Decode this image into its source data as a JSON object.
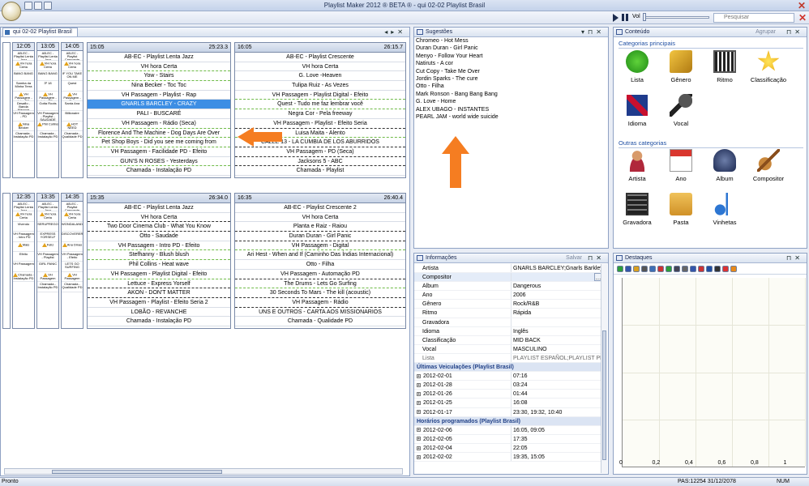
{
  "window": {
    "title": "Playlist Maker 2012 ® BETA ® - qui 02-02 Playlist Brasil"
  },
  "toolbar": {
    "volume_label": "Vol",
    "search_placeholder": "Pesquisar"
  },
  "schedule": {
    "tab": "qui 02-02 Playlist Brasil",
    "blocks": [
      {
        "time": "15:05",
        "duration": "25:23.3",
        "rows": [
          {
            "t": "AB-EC - Playlist Lenta Jazz",
            "s": ""
          },
          {
            "t": "VH hora Certa",
            "s": "dg"
          },
          {
            "t": "Yow - Stairs",
            "s": "dg"
          },
          {
            "t": "Nina Becker - Toc Toc",
            "s": ""
          },
          {
            "t": "VH Passagem - Playlist - Rap",
            "s": ""
          },
          {
            "t": "GNARLS BARCLEY - CRAZY",
            "s": "sel"
          },
          {
            "t": "PALI - BUSCARÉ",
            "s": ""
          },
          {
            "t": "VH Passagem - Rádio (Seca)",
            "s": "dg"
          },
          {
            "t": "Florence And The Machine - Dog Days Are Over",
            "s": "dg"
          },
          {
            "t": "Pet Shop Boys - Did you see me coming from",
            "s": "dg"
          },
          {
            "t": "VH Passagem - Facilidade PD - Efeito",
            "s": ""
          },
          {
            "t": "GUN'S N ROSES - Yesterdays",
            "s": "dg"
          },
          {
            "t": "Chamada - Instalação PD",
            "s": ""
          }
        ]
      },
      {
        "time": "16:05",
        "duration": "26:15.7",
        "rows": [
          {
            "t": "AB-EC - Playlist Crescente",
            "s": ""
          },
          {
            "t": "VH hora Certa",
            "s": ""
          },
          {
            "t": "G. Love -Heaven",
            "s": ""
          },
          {
            "t": "Tulipa Ruiz - As Vezes",
            "s": ""
          },
          {
            "t": "VH Passagem - Playlist Digital - Efeito",
            "s": "dg"
          },
          {
            "t": "Quest - Tudo me faz lembrar você",
            "s": "dg"
          },
          {
            "t": "Negra Cor - Pela freeway",
            "s": ""
          },
          {
            "t": "VH Passagem - Playlist - Efeito Seria",
            "s": "db"
          },
          {
            "t": "Luisa Maita - Alento",
            "s": "dg"
          },
          {
            "t": "CALLE 13 - LA CUMBIA DE LOS ABURRIDOS",
            "s": "db"
          },
          {
            "t": "VH Passagem - PD (Seca)",
            "s": "db"
          },
          {
            "t": "Jacksons 5 - ABC",
            "s": "db"
          },
          {
            "t": "Chamada - Playlist",
            "s": ""
          }
        ]
      },
      {
        "time": "15:35",
        "duration": "26:34.0",
        "rows": [
          {
            "t": "AB-EC - Playlist Lenta Jazz",
            "s": ""
          },
          {
            "t": "VH hora Certa",
            "s": "db"
          },
          {
            "t": "Two Door Cinema Club - What You Know",
            "s": "db"
          },
          {
            "t": "Otto - Saudade",
            "s": ""
          },
          {
            "t": "VH Passagem - Intro PD - Efeito",
            "s": "dg"
          },
          {
            "t": "Stefhanny - Blush blush",
            "s": "dg"
          },
          {
            "t": "Phil Collins - Heat wave",
            "s": ""
          },
          {
            "t": "VH Passagem - Playlist Digital - Efeito",
            "s": "dg"
          },
          {
            "t": "Lettuce - Express Yorself",
            "s": "db"
          },
          {
            "t": "AKON - DON'T MATTER",
            "s": "db"
          },
          {
            "t": "VH Passagem - Playlist - Efeito Seria 2",
            "s": ""
          },
          {
            "t": "LOBÃO - REVANCHE",
            "s": ""
          },
          {
            "t": "Chamada - Instalação PD",
            "s": ""
          }
        ]
      },
      {
        "time": "16:35",
        "duration": "26:40.4",
        "rows": [
          {
            "t": "AB-EC - Playlist Crescente 2",
            "s": ""
          },
          {
            "t": "VH hora Certa",
            "s": ""
          },
          {
            "t": "Planta e Raiz - Raiou",
            "s": "db"
          },
          {
            "t": "Duran Duran - Girl Panic",
            "s": "db"
          },
          {
            "t": "VH Passagem - Digital",
            "s": "dg"
          },
          {
            "t": "Ari Hest - When and If (Caminho Das Índias Internacional)",
            "s": ""
          },
          {
            "t": "Otto - Filha",
            "s": ""
          },
          {
            "t": "VH Passagem - Automação PD",
            "s": "db"
          },
          {
            "t": "The Drums - Lets Go Surfing",
            "s": "dg"
          },
          {
            "t": "30 Seconds To Mars - The kill (acoustic)",
            "s": "db"
          },
          {
            "t": "VH Passagem - Rádio",
            "s": "db"
          },
          {
            "t": "UNS E OUTROS - CARTA  AOS MISSIONARIOS",
            "s": ""
          },
          {
            "t": "Chamada - Qualidade PD",
            "s": ""
          }
        ]
      }
    ],
    "minis": [
      {
        "time": "12:05",
        "rows": [
          "AB-EC - Playlist Lenta Jazz",
          "VH hora Certa",
          "BANG BANG",
          "Samba da Minha Terra",
          "VH Passagem - Intro PD",
          "Desafio - Banda Mangue",
          "VH Passagem - PD",
          "Nina Becker",
          "Chamada - Instalação PD"
        ]
      },
      {
        "time": "13:05",
        "rows": [
          "AB-EC - Playlist Lenta Jazz",
          "VH hora Certa",
          "BANG BANG",
          "3º 18",
          "VH Passagem - Intro PD - Efeito",
          "Gotta Roots",
          "VH Passagem - Playlist - SAUDADE",
          "Phil Collins",
          "Chamada - Instalação PD"
        ]
      },
      {
        "time": "14:05",
        "rows": [
          "AB-EC - Playlist Crescente",
          "VH hora Certa",
          "IF YOU TAKE ON ME",
          "Quest",
          "VH Passagem - Rap",
          "Santa Ana",
          "Billionaire",
          "HOT NEED",
          "Chamada - Qualidade PD"
        ]
      },
      {
        "time": "12:35",
        "rows": [
          "AB-EC - Playlist Lenta Jazz",
          "VH hora Certa",
          "Vivendo",
          "VH Passagem - Intro PD",
          "Mais",
          "Efeito",
          "VH Passagem",
          "Chamada - Instalação PD"
        ]
      },
      {
        "time": "13:35",
        "rows": [
          "AB-EC - Playlist Lenta Jazz",
          "VH hora Certa",
          "SERUPREGO",
          "EXPRESS YORSELF",
          "Feliz",
          "VH Passagem - Playlist",
          "GIRL PANIC",
          "VH Passagem",
          "Chamada - Instalação PD"
        ]
      },
      {
        "time": "14:35",
        "rows": [
          "AB-EC - Playlist Crescente",
          "VH hora Certa",
          "WONDALAND",
          "DISCOVERER",
          "Ana Dinas",
          "VH Passagem - Efeito",
          "LETS GO SURFING",
          "VH Passagem",
          "Chamada - Qualidade PD"
        ]
      }
    ]
  },
  "suggestions": {
    "title": "Sugestões",
    "items": [
      "Chromeo - Hot Mess",
      "Duran Duran - Girl Panic",
      "Menyo - Follow Your Heart",
      "Natiruts - A cor",
      "Cut Copy - Take Me Over",
      "Jordin Sparks - The cure",
      "Otto - Filha",
      "Mark Ronson - Bang Bang Bang",
      "G. Love - Home",
      "ALEX UBAGO - INSTANTES",
      "PEARL JAM   - world wide suicide"
    ]
  },
  "content": {
    "title": "Conteúdo",
    "group_label": "Agrupar",
    "main_section": "Categorias principais",
    "other_section": "Outras categorias",
    "main": [
      "Lista",
      "Gênero",
      "Ritmo",
      "Classificação",
      "Idioma",
      "Vocal"
    ],
    "other": [
      "Artista",
      "Ano",
      "Album",
      "Compositor",
      "Gravadora",
      "Pasta",
      "Vinhetas"
    ]
  },
  "info": {
    "title": "Informações",
    "save_label": "Salvar",
    "fields": [
      [
        "Artista",
        "GNARLS BARCLEY;Gnarls Barkley"
      ],
      [
        "Compositor",
        ""
      ],
      [
        "Album",
        "Dangerous"
      ],
      [
        "Ano",
        "2006"
      ],
      [
        "Gênero",
        "Rock/R&B"
      ],
      [
        "Ritmo",
        "Rápida"
      ],
      [
        "Gravadora",
        ""
      ],
      [
        "Idioma",
        "Inglês"
      ],
      [
        "Classificação",
        "MID BACK"
      ],
      [
        "Vocal",
        "MASCULINO"
      ],
      [
        "Lista",
        "PLAYLIST ESPAÑOL;PLAYLIST PRO"
      ]
    ],
    "last_title": "Últimas Veiculações (Playlist Brasil)",
    "last": [
      [
        "2012-02-01",
        "07:16"
      ],
      [
        "2012-01-28",
        "03:24"
      ],
      [
        "2012-01-26",
        "01:44"
      ],
      [
        "2012-01-25",
        "16:08"
      ],
      [
        "2012-01-17",
        "23:30, 19:32, 10:40"
      ]
    ],
    "prog_title": "Horários programados (Playlist Brasil)",
    "prog": [
      [
        "2012-02-06",
        "16:05, 09:05"
      ],
      [
        "2012-02-05",
        "17:35"
      ],
      [
        "2012-02-04",
        "22:05"
      ],
      [
        "2012-02-02",
        "19:35, 15:05"
      ]
    ]
  },
  "highlights": {
    "title": "Destaques",
    "xticks": [
      "0",
      "0,2",
      "0,4",
      "0,6",
      "0,8",
      "1"
    ]
  },
  "status": {
    "left": "Pronto",
    "right": "PAS:12254 31/12/2078",
    "num": "NUM"
  }
}
